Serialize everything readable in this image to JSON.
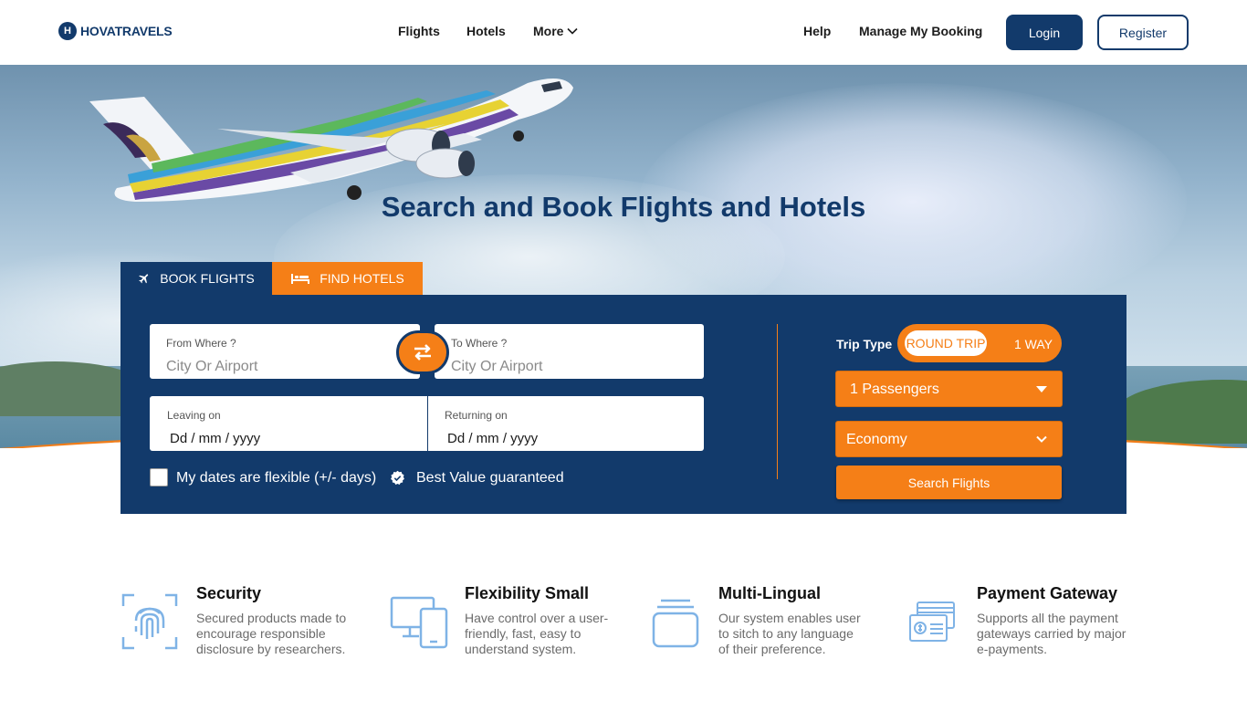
{
  "brand": {
    "mark": "H",
    "name": "HOVATRAVELS"
  },
  "nav": {
    "flights": "Flights",
    "hotels": "Hotels",
    "more": "More",
    "help": "Help",
    "manage": "Manage My Booking",
    "login": "Login",
    "register": "Register"
  },
  "hero": {
    "title": "Search and Book Flights and Hotels"
  },
  "tabs": {
    "book_flights": "BOOK FLIGHTS",
    "find_hotels": "FIND HOTELS"
  },
  "search": {
    "from": {
      "label": "From Where ?",
      "placeholder": "City Or Airport"
    },
    "to": {
      "label": "To Where ?",
      "placeholder": "City Or Airport"
    },
    "leaving": {
      "label": "Leaving on",
      "value": "Dd / mm / yyyy"
    },
    "returning": {
      "label": "Returning on",
      "value": "Dd / mm / yyyy"
    },
    "flexible_label": "My dates are flexible (+/- days)",
    "best_value_label": "Best Value guaranteed",
    "trip_type_label": "Trip Type",
    "trip_round": "ROUND TRIP",
    "trip_oneway": "1 WAY",
    "passengers": "1 Passengers",
    "cabin_class": "Economy",
    "submit": "Search Flights"
  },
  "features": [
    {
      "title": "Security",
      "desc": [
        "Secured products made to",
        "encourage responsible",
        "disclosure by researchers."
      ],
      "icon": "fingerprint-icon"
    },
    {
      "title": "Flexibility Small",
      "desc": [
        "Have control over a user-",
        "friendly, fast, easy to",
        "understand system."
      ],
      "icon": "devices-icon"
    },
    {
      "title": "Multi-Lingual",
      "desc": [
        "Our system enables user",
        "to sitch to any language",
        "of their preference."
      ],
      "icon": "stack-icon"
    },
    {
      "title": "Payment Gateway",
      "desc": [
        "Supports all the payment",
        "gateways carried by major",
        "e-payments."
      ],
      "icon": "payment-cards-icon"
    }
  ],
  "colors": {
    "navy": "#123a6b",
    "orange": "#f57f17",
    "icon_blue": "#7fb3e6"
  }
}
